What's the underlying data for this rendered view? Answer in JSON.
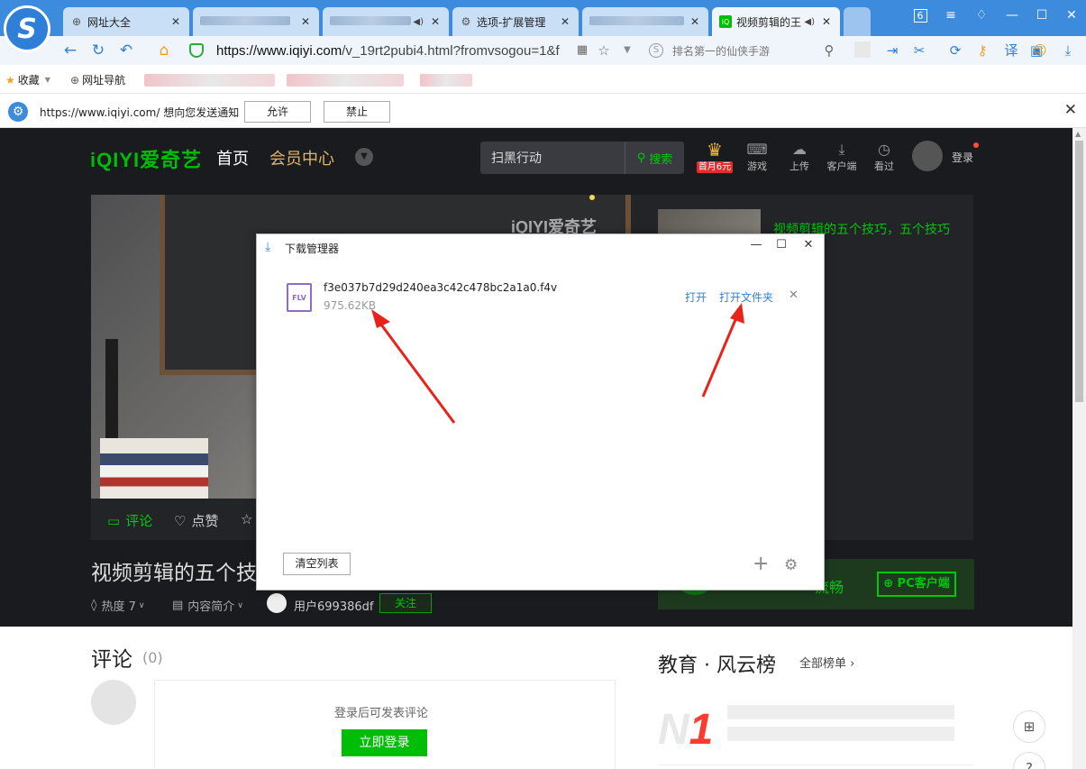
{
  "browser": {
    "tabs": [
      {
        "icon": "globe-icon",
        "label": "网址大全"
      },
      {
        "icon": "blurred",
        "label": ""
      },
      {
        "icon": "speaker-icon",
        "label": ""
      },
      {
        "icon": "gear-icon",
        "label": "选项-扩展管理"
      },
      {
        "icon": "blurred",
        "label": ""
      },
      {
        "icon": "iqiyi-icon",
        "label": "视频剪辑的王"
      }
    ],
    "window_badge": "6",
    "url_host": "https://www.iqiyi.com",
    "url_path": "/v_19rt2pubi4.html?fromvsogou=1&f",
    "search_placeholder": "排名第一的仙侠手游",
    "bookmarks": [
      {
        "icon": "star-icon",
        "label": "收藏"
      },
      {
        "icon": "globe-icon",
        "label": "网址导航"
      }
    ],
    "notify": {
      "message": "https://www.iqiyi.com/ 想向您发送通知",
      "allow": "允许",
      "deny": "禁止"
    }
  },
  "iqiyi": {
    "logo": "iQIYI爱奇艺",
    "nav": [
      "首页",
      "会员中心"
    ],
    "search_query": "扫黑行动",
    "search_button": "搜索",
    "vip_badge": "首月6元",
    "nav_icons": [
      {
        "icon": "gamepad-icon",
        "label": "游戏"
      },
      {
        "icon": "upload-icon",
        "label": "上传"
      },
      {
        "icon": "download-icon",
        "label": "客户端"
      },
      {
        "icon": "clock-icon",
        "label": "看过"
      }
    ],
    "login": "登录",
    "video_watermark": "iQIYI爱奇艺",
    "side_title": "视频剪辑的五个技巧，五个技巧\n明",
    "actions": {
      "comment": "评论",
      "like": "点赞"
    },
    "video_title": "视频剪辑的五个技",
    "meta": {
      "heat": "热度 7",
      "intro": "内容简介",
      "user": "用户699386df",
      "follow": "关注"
    },
    "pc_bar": {
      "text": "流畅",
      "button": "PC客户端"
    },
    "comments": {
      "title": "评论",
      "count": "(0)",
      "tip": "登录后可发表评论",
      "login_button": "立即登录"
    },
    "rank": {
      "title": "教育 · 风云榜",
      "all": "全部榜单"
    }
  },
  "download_dialog": {
    "title": "下载管理器",
    "file_type": "FLV",
    "file_name": "f3e037b7d29d240ea3c42c478bc2a1a0.f4v",
    "file_size": "975.62KB",
    "open": "打开",
    "open_folder": "打开文件夹",
    "clear_list": "清空列表"
  },
  "colors": {
    "browser_blue": "#3d8bdc",
    "iqiyi_green": "#00be06",
    "arrow_red": "#e8231c"
  }
}
